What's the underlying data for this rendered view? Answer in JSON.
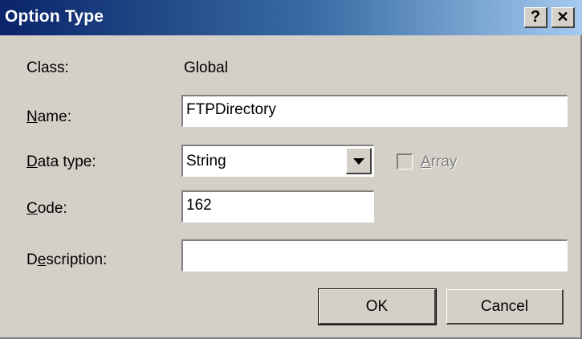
{
  "window": {
    "title": "Option Type",
    "help_label": "?",
    "close_label": "✕"
  },
  "form": {
    "class": {
      "label": "Class:",
      "value": "Global"
    },
    "name": {
      "label_mnemonic": "N",
      "label_rest": "ame:",
      "value": "FTPDirectory"
    },
    "data_type": {
      "label_mnemonic": "D",
      "label_rest": "ata type:",
      "value": "String"
    },
    "array": {
      "label_mnemonic": "A",
      "label_rest": "rray",
      "checked": false,
      "enabled": false
    },
    "code": {
      "label_mnemonic": "C",
      "label_rest": "ode:",
      "value": "162"
    },
    "description": {
      "label_pre": "D",
      "label_mnemonic": "e",
      "label_rest": "scription:",
      "value": ""
    }
  },
  "buttons": {
    "ok": "OK",
    "cancel": "Cancel"
  }
}
